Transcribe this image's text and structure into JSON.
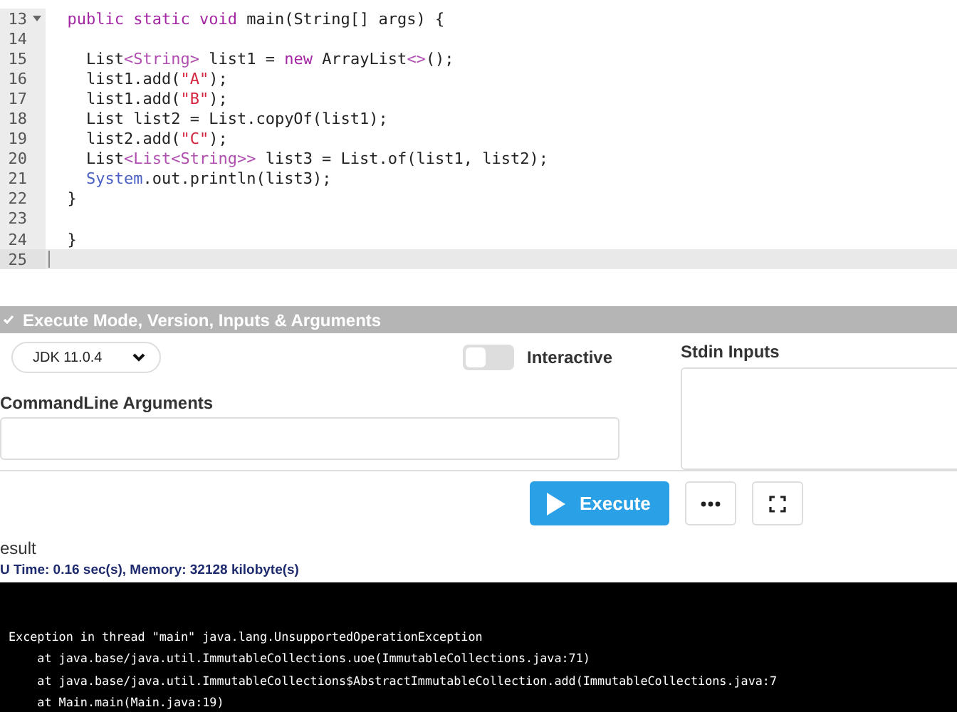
{
  "editor": {
    "lines": [
      {
        "number": "13",
        "foldable": true,
        "current": false,
        "tokens": [
          {
            "text": "  public static void",
            "kind": "kw"
          },
          {
            "text": " main(String[] args) {",
            "kind": "plain"
          }
        ]
      },
      {
        "number": "14",
        "foldable": false,
        "current": false
      },
      {
        "number": "15",
        "foldable": false,
        "current": false,
        "tokens": [
          {
            "text": "    List",
            "kind": "plain"
          },
          {
            "text": "<String>",
            "kind": "type"
          },
          {
            "text": " list1 = ",
            "kind": "plain"
          },
          {
            "text": "new",
            "kind": "kw"
          },
          {
            "text": " ArrayList",
            "kind": "plain"
          },
          {
            "text": "<>",
            "kind": "type"
          },
          {
            "text": "();",
            "kind": "plain"
          }
        ]
      },
      {
        "number": "16",
        "foldable": false,
        "current": false,
        "tokens": [
          {
            "text": "    list1.add(",
            "kind": "plain"
          },
          {
            "text": "\"A\"",
            "kind": "str"
          },
          {
            "text": ");",
            "kind": "plain"
          }
        ]
      },
      {
        "number": "17",
        "foldable": false,
        "current": false,
        "tokens": [
          {
            "text": "    list1.add(",
            "kind": "plain"
          },
          {
            "text": "\"B\"",
            "kind": "str"
          },
          {
            "text": ");",
            "kind": "plain"
          }
        ]
      },
      {
        "number": "18",
        "foldable": false,
        "current": false,
        "tokens": [
          {
            "text": "    List list2 = List.copyOf(list1);",
            "kind": "plain"
          }
        ]
      },
      {
        "number": "19",
        "foldable": false,
        "current": false,
        "tokens": [
          {
            "text": "    list2.add(",
            "kind": "plain"
          },
          {
            "text": "\"C\"",
            "kind": "str"
          },
          {
            "text": ");",
            "kind": "plain"
          }
        ]
      },
      {
        "number": "20",
        "foldable": false,
        "current": false,
        "tokens": [
          {
            "text": "    List",
            "kind": "plain"
          },
          {
            "text": "<List<String>>",
            "kind": "type"
          },
          {
            "text": " list3 = List.of(list1, list2);",
            "kind": "plain"
          }
        ]
      },
      {
        "number": "21",
        "foldable": false,
        "current": false,
        "tokens": [
          {
            "text": "    System",
            "kind": "sys"
          },
          {
            "text": ".out.println(list3);",
            "kind": "plain"
          }
        ]
      },
      {
        "number": "22",
        "foldable": false,
        "current": false,
        "tokens": [
          {
            "text": "  }",
            "kind": "plain"
          }
        ]
      },
      {
        "number": "23",
        "foldable": false,
        "current": false
      },
      {
        "number": "24",
        "foldable": false,
        "current": false,
        "tokens": [
          {
            "text": "  }",
            "kind": "plain"
          }
        ]
      },
      {
        "number": "25",
        "foldable": false,
        "current": true
      }
    ]
  },
  "options": {
    "header": "Execute Mode, Version, Inputs & Arguments",
    "expanded": true,
    "version": "JDK 11.0.4",
    "interactive": {
      "label": "Interactive",
      "on": false
    },
    "stdin_label": "Stdin Inputs",
    "args_label": "CommandLine Arguments"
  },
  "actions": {
    "execute": "Execute"
  },
  "result": {
    "title": "esult",
    "stats": "U Time: 0.16 sec(s), Memory: 32128 kilobyte(s)",
    "output": [
      "Exception in thread \"main\" java.lang.UnsupportedOperationException",
      "    at java.base/java.util.ImmutableCollections.uoe(ImmutableCollections.java:71)",
      "    at java.base/java.util.ImmutableCollections$AbstractImmutableCollection.add(ImmutableCollections.java:7",
      "    at Main.main(Main.java:19)"
    ]
  }
}
